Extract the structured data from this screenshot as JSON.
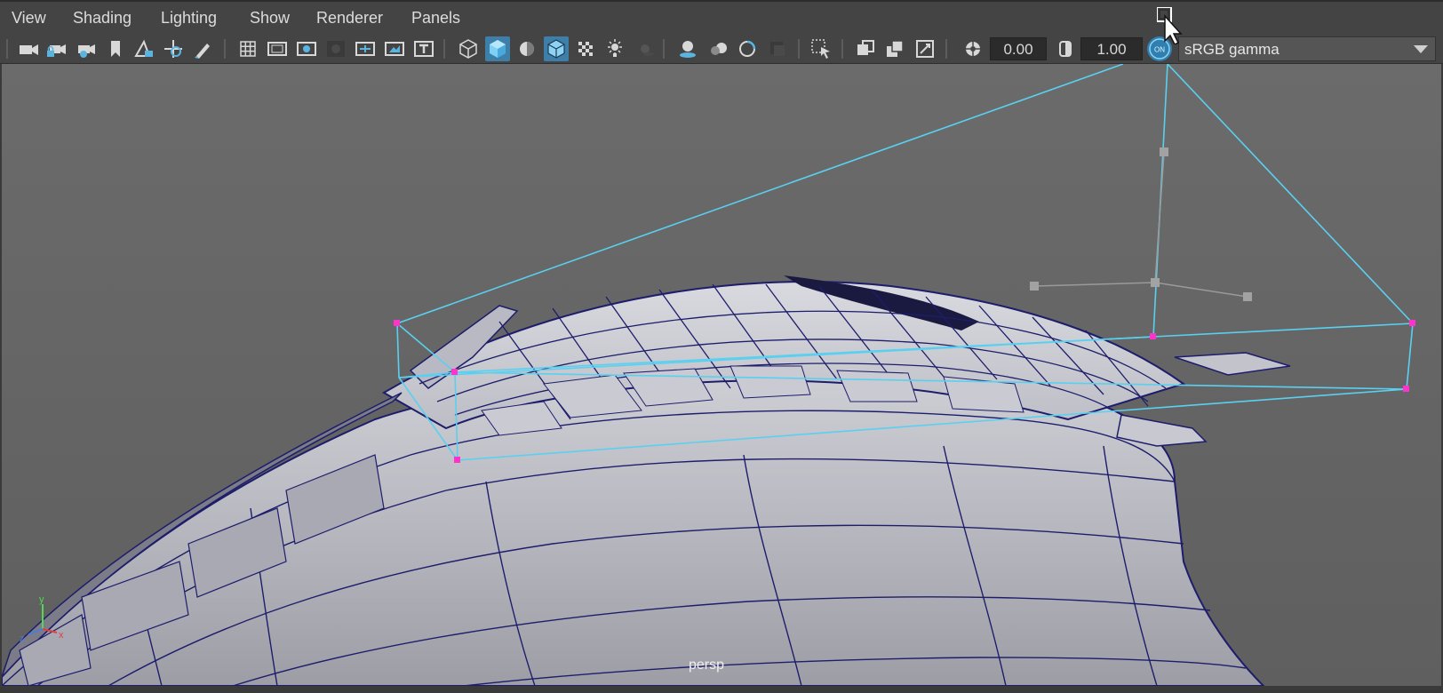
{
  "menu": {
    "items": [
      "View",
      "Shading",
      "Lighting",
      "Show",
      "Renderer",
      "Panels"
    ]
  },
  "toolbar": {
    "icons": [
      "select-camera-icon",
      "lock-camera-icon",
      "camera-attributes-icon",
      "bookmark-icon",
      "image-plane-icon",
      "2d-pan-zoom-icon",
      "grease-pencil-icon",
      "grid-icon",
      "film-gate-icon",
      "resolution-gate-icon",
      "gate-mask-icon",
      "field-chart-icon",
      "safe-action-icon",
      "safe-title-icon",
      "wireframe-icon",
      "smooth-shade-all-icon",
      "use-default-material-icon",
      "wireframe-on-shaded-icon",
      "xray-icon",
      "use-all-lights-icon",
      "shadows-icon",
      "screen-space-ambient-occlusion-icon",
      "motion-blur-icon",
      "multisample-antialiasing-icon",
      "depth-of-field-icon",
      "isolate-select-icon",
      "xray-joints-icon",
      "xray-active-components-icon",
      "backface-culling-icon",
      "exposure-icon",
      "gamma-icon",
      "color-management-icon"
    ],
    "exposure_value": "0.00",
    "gamma_value": "1.00",
    "color_management_toggle": "ON",
    "view_transform": "sRGB gamma"
  },
  "viewport": {
    "camera_name": "persp",
    "axis_labels": {
      "x": "x",
      "y": "y",
      "z": "z"
    },
    "colors": {
      "background": "#666666",
      "wire": "#1d1d6b",
      "selection": "#5ad0f0",
      "vertex": "#ff33cc",
      "manipulator": "#9a9a9a"
    }
  },
  "cursor": {
    "name": "mouse-pointer-icon"
  }
}
